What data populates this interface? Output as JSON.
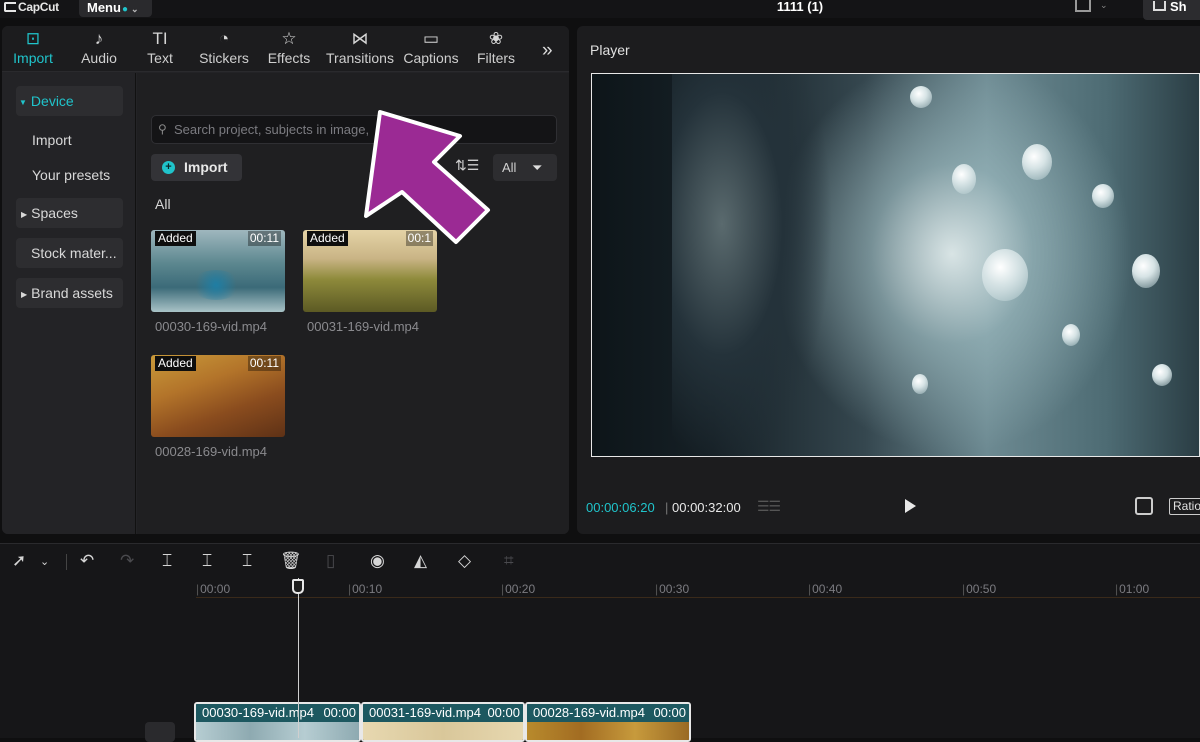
{
  "app": {
    "logo": "CapCut",
    "menu_label": "Menu",
    "project_title": "1111 (1)",
    "share_label": "Sh"
  },
  "tabs": [
    {
      "label": "Import",
      "icon": "import-icon",
      "glyph": "⊡"
    },
    {
      "label": "Audio",
      "icon": "audio-icon",
      "glyph": "♪"
    },
    {
      "label": "Text",
      "icon": "text-icon",
      "glyph": "TI"
    },
    {
      "label": "Stickers",
      "icon": "stickers-icon",
      "glyph": "◔"
    },
    {
      "label": "Effects",
      "icon": "effects-icon",
      "glyph": "☆"
    },
    {
      "label": "Transitions",
      "icon": "transitions-icon",
      "glyph": "⋈"
    },
    {
      "label": "Captions",
      "icon": "captions-icon",
      "glyph": "▭"
    },
    {
      "label": "Filters",
      "icon": "filters-icon",
      "glyph": "❀"
    }
  ],
  "sidebar": {
    "device": "Device",
    "import": "Import",
    "presets": "Your presets",
    "spaces": "Spaces",
    "stock": "Stock mater...",
    "brand": "Brand assets"
  },
  "search": {
    "placeholder": "Search project, subjects in image,"
  },
  "toolbar": {
    "import_label": "Import",
    "filter_label": "All",
    "section_label": "All"
  },
  "media": [
    {
      "badge": "Added",
      "duration": "00:11",
      "name": "00030-169-vid.mp4"
    },
    {
      "badge": "Added",
      "duration": "00:1",
      "name": "00031-169-vid.mp4"
    },
    {
      "badge": "Added",
      "duration": "00:11",
      "name": "00028-169-vid.mp4"
    }
  ],
  "player": {
    "title": "Player",
    "current_time": "00:00:06:20",
    "separator": "|",
    "total_time": "00:00:32:00",
    "ratio_label": "Ratio"
  },
  "timeline": {
    "ticks": [
      "00:00",
      "00:10",
      "00:20",
      "00:30",
      "00:40",
      "00:50",
      "01:00"
    ],
    "clips": [
      {
        "name": "00030-169-vid.mp4",
        "duration": "00:00"
      },
      {
        "name": "00031-169-vid.mp4",
        "duration": "00:00"
      },
      {
        "name": "00028-169-vid.mp4",
        "duration": "00:00"
      }
    ]
  },
  "colors": {
    "accent": "#20c4cb",
    "annotation_arrow": "#9b2a94"
  }
}
